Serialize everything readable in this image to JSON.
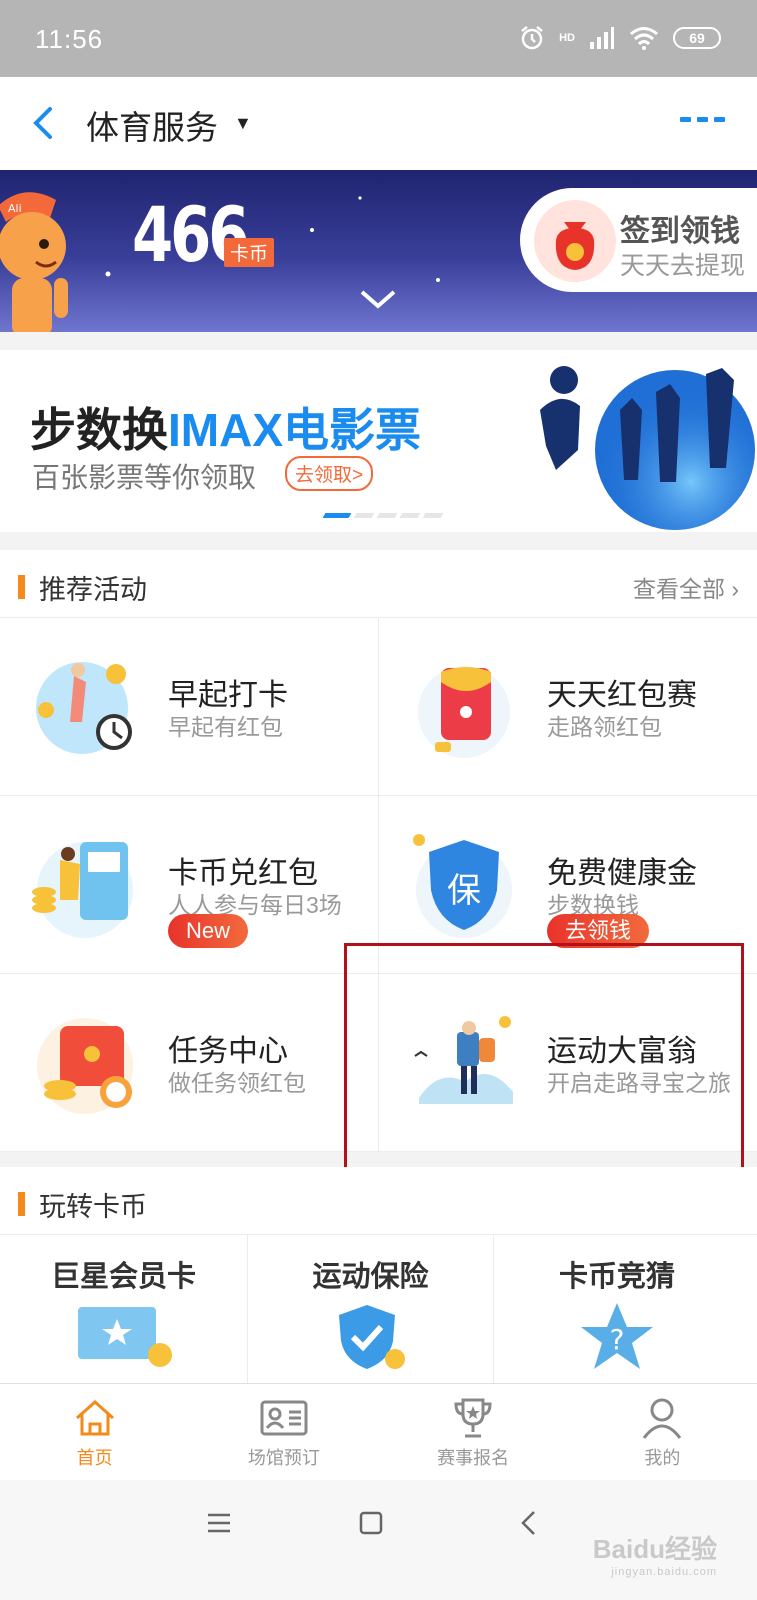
{
  "status_bar": {
    "time": "11:56",
    "battery": "69",
    "network": "HD"
  },
  "header": {
    "title": "体育服务"
  },
  "coin_banner": {
    "coins": "466",
    "unit": "卡币",
    "signin_title": "签到领钱",
    "signin_sub": "天天去提现"
  },
  "promo": {
    "headline_prefix": "步数换",
    "headline_highlight": "IMAX电影票",
    "sub": "百张影票等你领取",
    "cta": "去领取>",
    "page_count": 5,
    "page_active": 1
  },
  "recommended": {
    "title": "推荐活动",
    "more": "查看全部",
    "items": [
      {
        "name": "早起打卡",
        "desc": "早起有红包",
        "tag": ""
      },
      {
        "name": "天天红包赛",
        "desc": "走路领红包",
        "tag": ""
      },
      {
        "name": "卡币兑红包",
        "desc": "人人参与每日3场",
        "tag": "New"
      },
      {
        "name": "免费健康金",
        "desc": "步数换钱",
        "tag": "去领钱"
      },
      {
        "name": "任务中心",
        "desc": "做任务领红包",
        "tag": ""
      },
      {
        "name": "运动大富翁",
        "desc": "开启走路寻宝之旅",
        "tag": ""
      }
    ]
  },
  "play_coins": {
    "title": "玩转卡币",
    "cards": [
      {
        "name": "巨星会员卡"
      },
      {
        "name": "运动保险"
      },
      {
        "name": "卡币竞猜"
      }
    ]
  },
  "tabbar": {
    "tabs": [
      {
        "label": "首页",
        "icon": "home-icon",
        "active": true
      },
      {
        "label": "场馆预订",
        "icon": "id-card-icon",
        "active": false
      },
      {
        "label": "赛事报名",
        "icon": "trophy-icon",
        "active": false
      },
      {
        "label": "我的",
        "icon": "user-icon",
        "active": false
      }
    ]
  },
  "watermark": {
    "brand": "Baidu经验",
    "url": "jingyan.baidu.com"
  },
  "colors": {
    "accent_blue": "#1a8cf0",
    "accent_orange": "#f48a1a",
    "accent_red": "#e8332b",
    "highlight_box": "#b3101b"
  }
}
